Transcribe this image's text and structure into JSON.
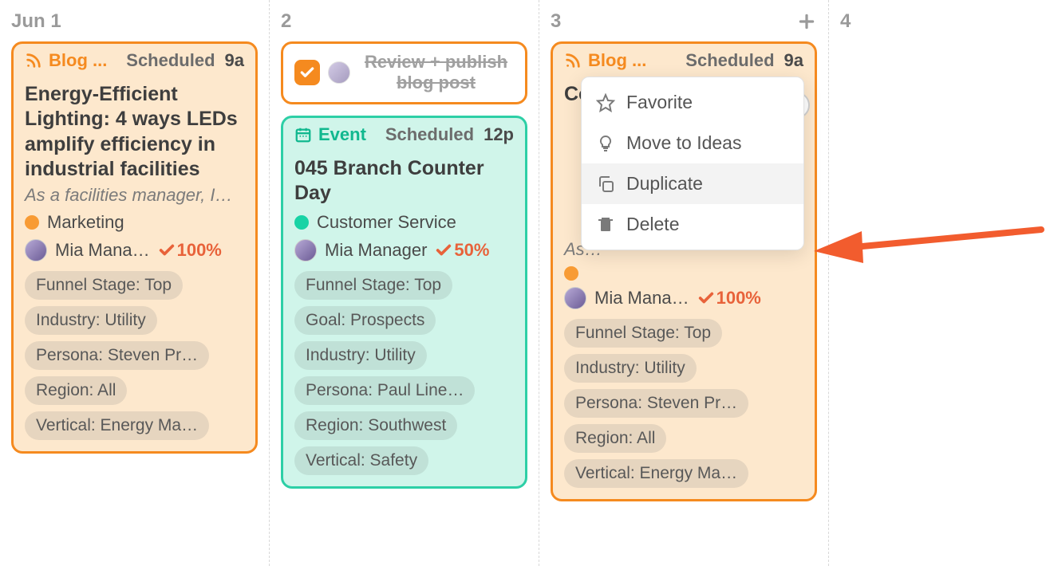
{
  "columns": {
    "c0": {
      "label": "Jun 1"
    },
    "c1": {
      "label": "2"
    },
    "c2": {
      "label": "3"
    },
    "c3": {
      "label": "4"
    }
  },
  "cards": {
    "a": {
      "type_label": "Blog ...",
      "status": "Scheduled",
      "time": "9a",
      "title": "Energy-Efficient Lighting: 4 ways LEDs amplify efficiency in industrial facilities",
      "subtitle": "As a facilities manager, I…",
      "category": "Marketing",
      "user": "Mia Mana…",
      "progress": "100%",
      "tags": [
        "Funnel Stage: Top",
        "Industry: Utility",
        "Persona: Steven Pr…",
        "Region: All",
        "Vertical: Energy Ma…"
      ]
    },
    "task": {
      "text": "Review + publish blog post"
    },
    "b": {
      "type_label": "Event",
      "status": "Scheduled",
      "time": "12p",
      "title": "045 Branch Counter Day",
      "category": "Customer Service",
      "user": "Mia Manager",
      "progress": "50%",
      "tags": [
        "Funnel Stage: Top",
        "Goal: Prospects",
        "Industry: Utility",
        "Persona: Paul Line…",
        "Region: Southwest",
        "Vertical: Safety"
      ]
    },
    "c": {
      "type_label": "Blog ...",
      "status": "Scheduled",
      "time": "9a",
      "title": "Construction Project M…",
      "subtitle": "As…",
      "category": "",
      "user": "Mia Mana…",
      "progress": "100%",
      "tags": [
        "Funnel Stage: Top",
        "Industry: Utility",
        "Persona: Steven Pr…",
        "Region: All",
        "Vertical: Energy Ma…"
      ]
    }
  },
  "menu": {
    "favorite": "Favorite",
    "move": "Move to Ideas",
    "duplicate": "Duplicate",
    "delete": "Delete"
  }
}
